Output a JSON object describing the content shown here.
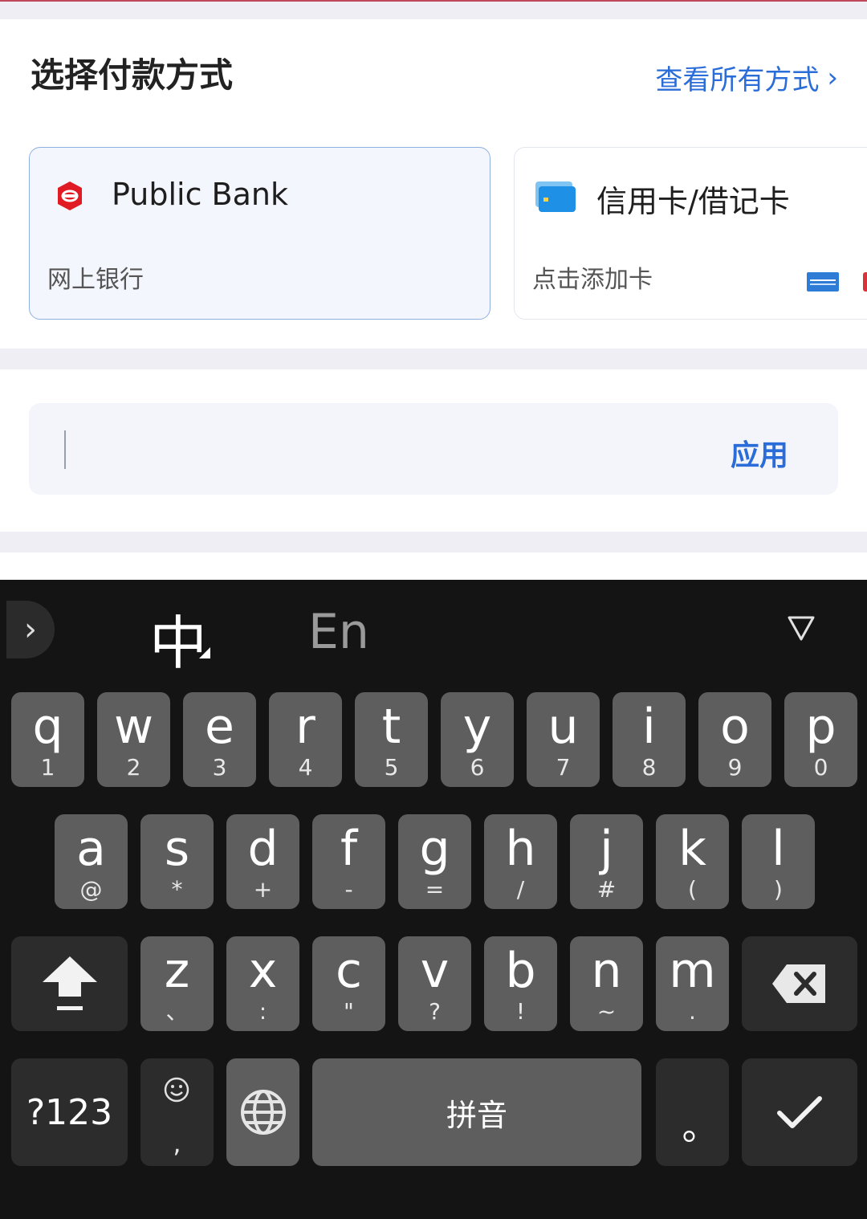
{
  "header": {
    "title": "选择付款方式",
    "view_all": "查看所有方式",
    "view_all_chevron": "›"
  },
  "payment_methods": [
    {
      "title": "Public Bank",
      "subtitle": "网上银行",
      "icon": "public-bank-logo-icon",
      "selected": true
    },
    {
      "title": "信用卡/借记卡",
      "subtitle": "点击添加卡",
      "icon": "credit-card-icon",
      "selected": false
    }
  ],
  "promo": {
    "apply_label": "应用",
    "value": ""
  },
  "keyboard": {
    "collapse": "›",
    "mode_zh": "中",
    "mode_en": "En",
    "row1": [
      {
        "main": "q",
        "sub": "1"
      },
      {
        "main": "w",
        "sub": "2"
      },
      {
        "main": "e",
        "sub": "3"
      },
      {
        "main": "r",
        "sub": "4"
      },
      {
        "main": "t",
        "sub": "5"
      },
      {
        "main": "y",
        "sub": "6"
      },
      {
        "main": "u",
        "sub": "7"
      },
      {
        "main": "i",
        "sub": "8"
      },
      {
        "main": "o",
        "sub": "9"
      },
      {
        "main": "p",
        "sub": "0"
      }
    ],
    "row2": [
      {
        "main": "a",
        "sub": "@"
      },
      {
        "main": "s",
        "sub": "*"
      },
      {
        "main": "d",
        "sub": "+"
      },
      {
        "main": "f",
        "sub": "-"
      },
      {
        "main": "g",
        "sub": "="
      },
      {
        "main": "h",
        "sub": "/"
      },
      {
        "main": "j",
        "sub": "#"
      },
      {
        "main": "k",
        "sub": "("
      },
      {
        "main": "l",
        "sub": ")"
      }
    ],
    "row3": [
      {
        "main": "z",
        "sub": "、"
      },
      {
        "main": "x",
        "sub": ":"
      },
      {
        "main": "c",
        "sub": "\""
      },
      {
        "main": "v",
        "sub": "?"
      },
      {
        "main": "b",
        "sub": "!"
      },
      {
        "main": "n",
        "sub": "~"
      },
      {
        "main": "m",
        "sub": "."
      }
    ],
    "symbols_label": "?123",
    "emoji_sub": ",",
    "space_label": "拼音",
    "period_label": "。",
    "enter_icon": "checkmark-icon"
  }
}
